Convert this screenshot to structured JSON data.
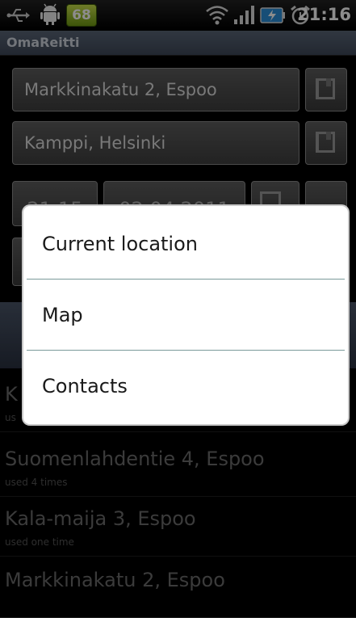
{
  "status_bar": {
    "time": "21:16",
    "badge": "68",
    "icons": [
      "usb-icon",
      "android-debug-icon",
      "wifi-icon",
      "signal-icon",
      "battery-charging-icon",
      "alarm-icon"
    ]
  },
  "app": {
    "title": "OmaReitti"
  },
  "form": {
    "from": "Markkinakatu 2, Espoo",
    "to": "Kamppi, Helsinki",
    "time": "21:15",
    "date": "02.04.2011"
  },
  "history": [
    {
      "title": "K",
      "sub": "us"
    },
    {
      "title": "Suomenlahdentie 4, Espoo",
      "sub": "used 4 times"
    },
    {
      "title": "Kala-maija 3, Espoo",
      "sub": "used one time"
    },
    {
      "title": "Markkinakatu 2, Espoo",
      "sub": ""
    }
  ],
  "popup": {
    "items": [
      {
        "label": "Current location"
      },
      {
        "label": "Map"
      },
      {
        "label": "Contacts"
      }
    ]
  }
}
